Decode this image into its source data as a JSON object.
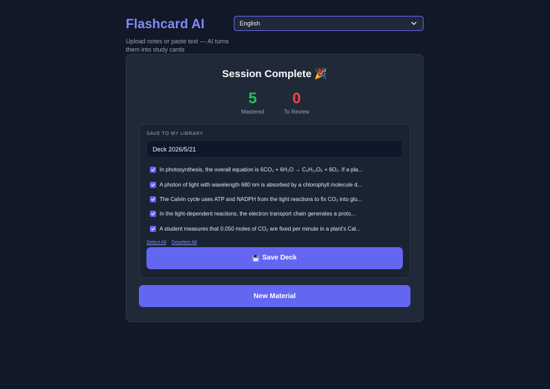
{
  "header": {
    "title": "Flashcard AI",
    "subtitle": "Upload notes or paste text — AI turns them into study cards"
  },
  "language": {
    "selected": "English"
  },
  "session": {
    "title": "Session Complete",
    "emoji": "🎉",
    "mastered": {
      "count": "5",
      "label": "Mastered"
    },
    "review": {
      "count": "0",
      "label": "To Review"
    }
  },
  "library": {
    "label": "Save to my library",
    "deck_name": "Deck 2026/5/21",
    "items": [
      {
        "text": "In photosynthesis, the overall equation is 6CO₂ + 6H₂O → C₆H₁₂O₆ + 6O₂. If a pla...",
        "checked": true
      },
      {
        "text": "A photon of light with wavelength 680 nm is absorbed by a chlorophyll molecule d...",
        "checked": true
      },
      {
        "text": "The Calvin cycle uses ATP and NADPH from the light reactions to fix CO₂ into glu...",
        "checked": true
      },
      {
        "text": "In the light-dependent reactions, the electron transport chain generates a proto...",
        "checked": true
      },
      {
        "text": "A student measures that 0.050 moles of CO₂ are fixed per minute in a plant's Cal...",
        "checked": true
      }
    ],
    "select_all": "Select All",
    "deselect_all": "Deselect All",
    "save_label": "Save Deck",
    "save_icon": "floppy-disk-icon"
  },
  "new_material_label": "New Material",
  "colors": {
    "background": "#111827",
    "card": "#1f2937",
    "accent": "#6366f1",
    "brand": "#818cf8",
    "mastered": "#22c55e",
    "review": "#ef4444"
  }
}
